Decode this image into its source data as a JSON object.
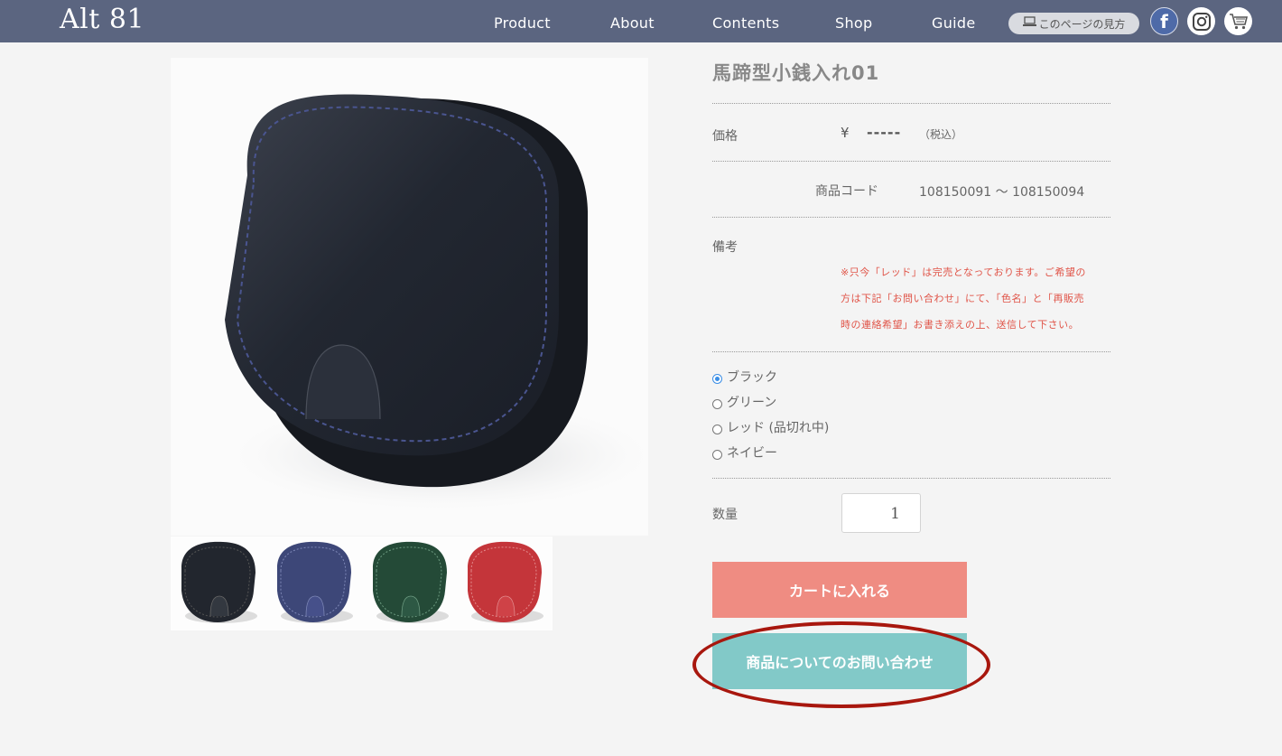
{
  "header": {
    "logo": "Alt 81",
    "nav": [
      "Product",
      "About",
      "Contents",
      "Shop",
      "Guide"
    ],
    "howto_label": "このページの見方",
    "icons": [
      "laptop-icon",
      "facebook-icon",
      "instagram-icon",
      "cart-icon"
    ],
    "bg_color": "#5b6580"
  },
  "product": {
    "title": "馬蹄型小銭入れ01",
    "price_label": "価格",
    "price_symbol": "¥",
    "price_value": "-----",
    "tax_note": "（税込）",
    "code_label": "商品コード",
    "code_value": "108150091 〜 108150094",
    "remarks_label": "備考",
    "remarks_lines": [
      "※只今「レッド」は完売となっております。ご希望の",
      "方は下記「お問い合わせ」にて、「色名」と「再販売",
      "時の連絡希望」お書き添えの上、送信して下さい。"
    ],
    "colors": [
      {
        "label": "ブラック",
        "selected": true
      },
      {
        "label": "グリーン",
        "selected": false
      },
      {
        "label": "レッド (品切れ中)",
        "selected": false
      },
      {
        "label": "ネイビー",
        "selected": false
      }
    ],
    "quantity_label": "数量",
    "quantity_value": "1",
    "add_to_cart_label": "カートに入れる",
    "inquiry_label": "商品についてのお問い合わせ",
    "thumbnails": [
      "black",
      "navy",
      "green",
      "red"
    ]
  },
  "colors": {
    "cart_button": "#ef8c82",
    "inquiry_button": "#82c9c8",
    "highlight_ring": "#a8170e",
    "remarks_text": "#e05448"
  }
}
